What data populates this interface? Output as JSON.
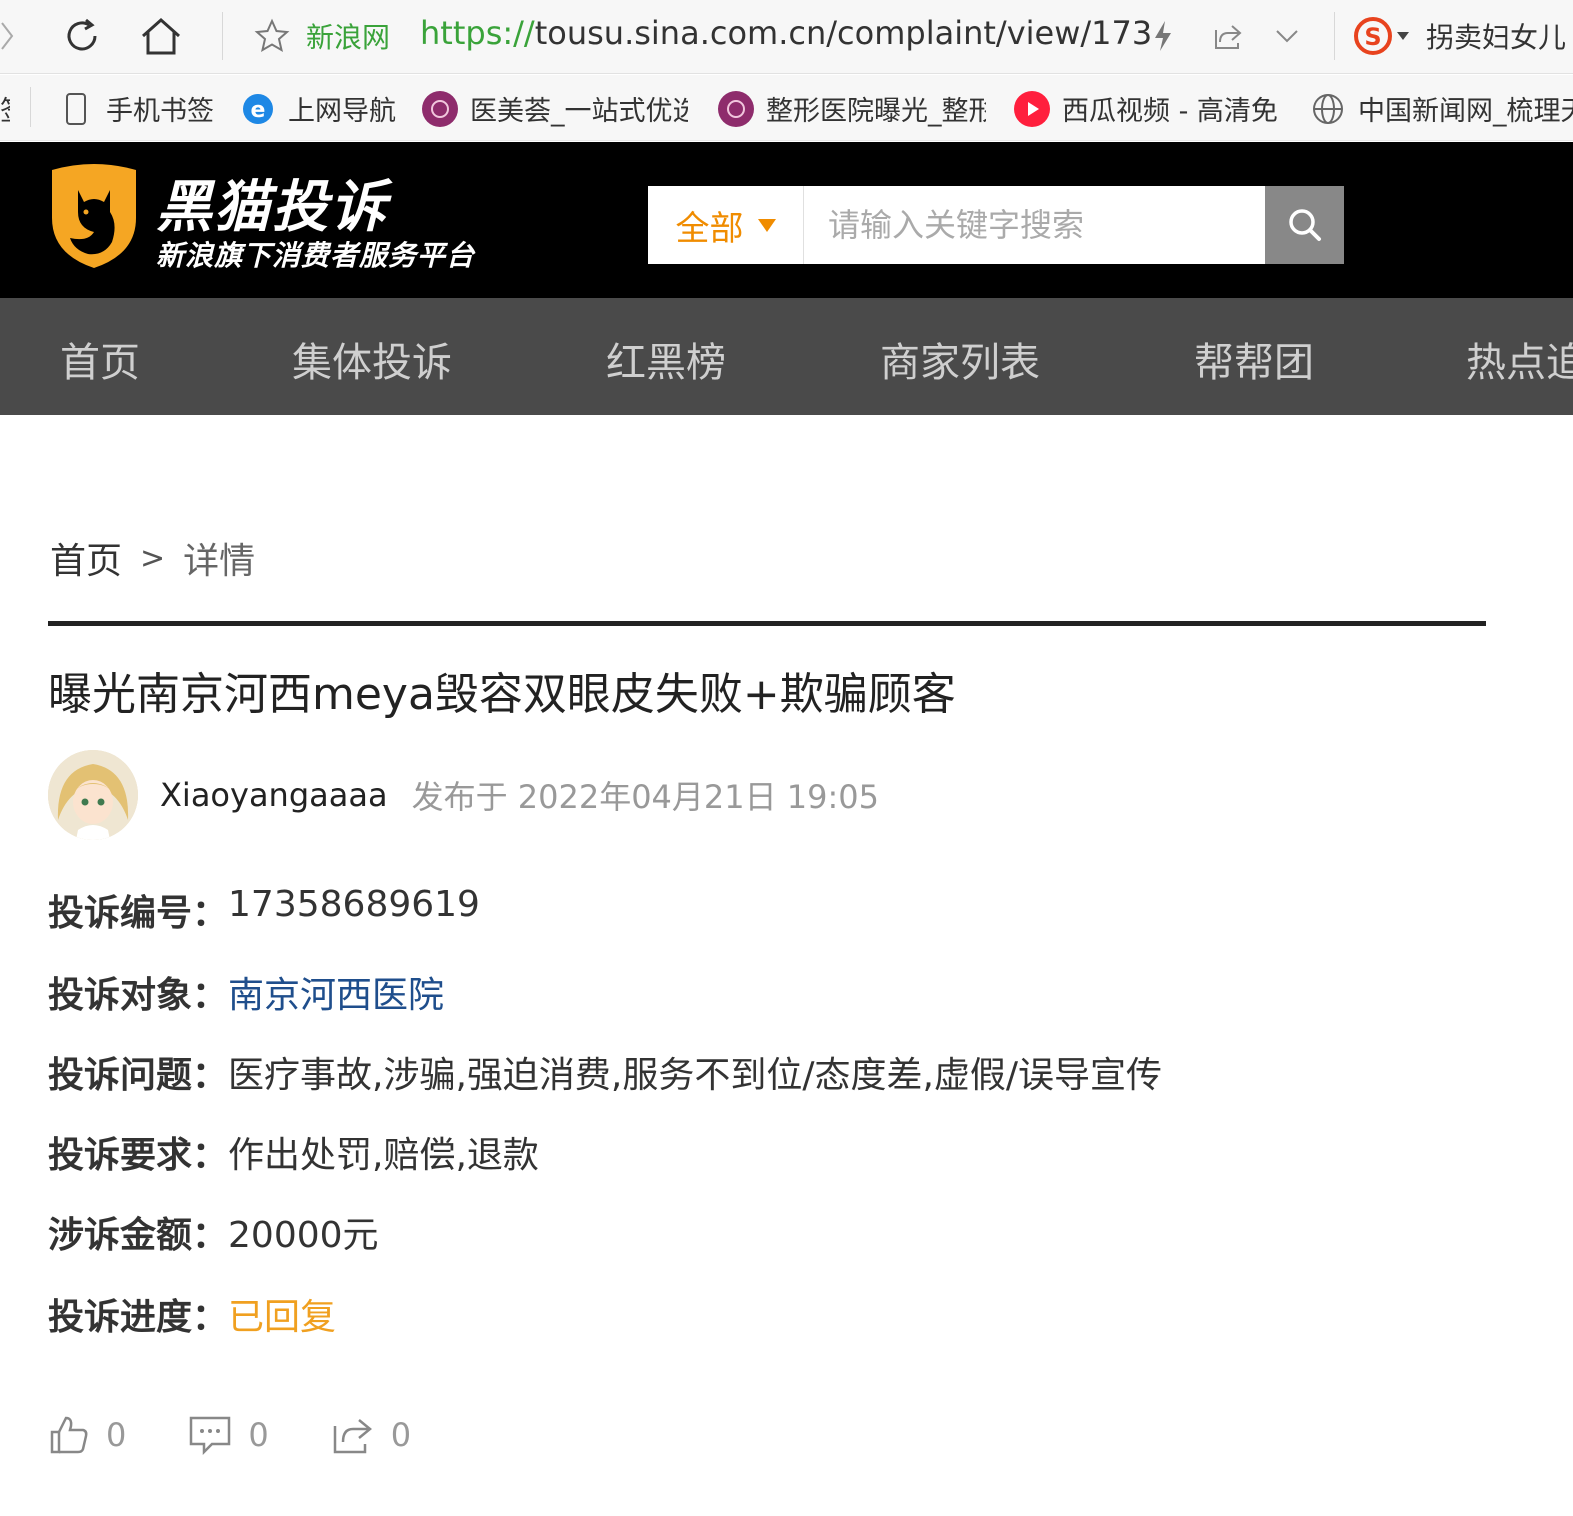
{
  "browser": {
    "site_title": "新浪网",
    "url_scheme": "https://",
    "url_rest": "tousu.sina.com.cn/complaint/view/173",
    "right_text": "拐卖妇女儿"
  },
  "bookmarks": [
    {
      "label": "手机书签",
      "icon": "phone-icon"
    },
    {
      "label": "上网导航",
      "icon": "ie-icon"
    },
    {
      "label": "医美荟_一站式优选",
      "icon": "yimeihui-icon"
    },
    {
      "label": "整形医院曝光_整形",
      "icon": "yimeihui-icon"
    },
    {
      "label": "西瓜视频 - 高清免",
      "icon": "xigua-icon"
    },
    {
      "label": "中国新闻网_梳理天",
      "icon": "globe-icon"
    }
  ],
  "header": {
    "logo_title": "黑猫投诉",
    "logo_subtitle": "新浪旗下消费者服务平台",
    "search_category": "全部",
    "search_placeholder": "请输入关键字搜索"
  },
  "nav": [
    "首页",
    "集体投诉",
    "红黑榜",
    "商家列表",
    "帮帮团",
    "热点追"
  ],
  "breadcrumb": {
    "home": "首页",
    "separator": ">",
    "current": "详情"
  },
  "complaint": {
    "title": "曝光南京河西meya毁容双眼皮失败+欺骗顾客",
    "author": "Xiaoyangaaaa",
    "published": "发布于 2022年04月21日 19:05",
    "fields": [
      {
        "label": "投诉编号：",
        "value": "17358689619",
        "style": "plain"
      },
      {
        "label": "投诉对象：",
        "value": "南京河西医院",
        "style": "link"
      },
      {
        "label": "投诉问题：",
        "value": "医疗事故,涉骗,强迫消费,服务不到位/态度差,虚假/误导宣传",
        "style": "plain"
      },
      {
        "label": "投诉要求：",
        "value": "作出处罚,赔偿,退款",
        "style": "plain"
      },
      {
        "label": "涉诉金额：",
        "value": "20000元",
        "style": "plain"
      },
      {
        "label": "投诉进度：",
        "value": "已回复",
        "style": "status"
      }
    ]
  },
  "actions": {
    "likes": "0",
    "comments": "0",
    "shares": "0"
  },
  "colors": {
    "accent_orange": "#f08c00",
    "link_blue": "#1f4e8c",
    "status_orange": "#f0a020",
    "nav_bg": "#4a4a4a",
    "header_bg": "#000000"
  }
}
